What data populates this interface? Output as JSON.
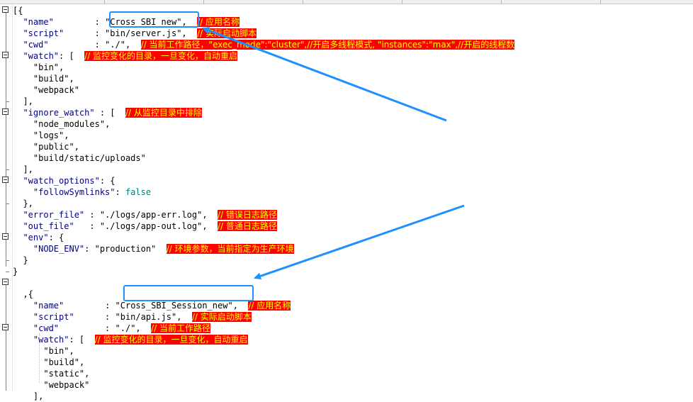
{
  "editor": {
    "lines": [
      [
        {
          "t": "punc",
          "v": "[{"
        }
      ],
      [
        {
          "t": "sp",
          "v": "  "
        },
        {
          "t": "key",
          "v": "\"name\""
        },
        {
          "t": "sp",
          "v": "        : "
        },
        {
          "t": "str",
          "v": "\"Cross_SBI_new\""
        },
        {
          "t": "punc",
          "v": ",  "
        },
        {
          "t": "cmt",
          "v": "// 应用名称"
        }
      ],
      [
        {
          "t": "sp",
          "v": "  "
        },
        {
          "t": "key",
          "v": "\"script\""
        },
        {
          "t": "sp",
          "v": "      : "
        },
        {
          "t": "str",
          "v": "\"bin/server.js\""
        },
        {
          "t": "punc",
          "v": ",  "
        },
        {
          "t": "cmt",
          "v": "// 实际启动脚本"
        }
      ],
      [
        {
          "t": "sp",
          "v": "  "
        },
        {
          "t": "key",
          "v": "\"cwd\""
        },
        {
          "t": "sp",
          "v": "         : "
        },
        {
          "t": "str",
          "v": "\"./\""
        },
        {
          "t": "punc",
          "v": ",  "
        },
        {
          "t": "cmt",
          "v": "// 当前工作路径，\"exec_mode\":\"cluster\",//开启多线程模式, \"instances\":\"max\",//开启的线程数"
        }
      ],
      [
        {
          "t": "sp",
          "v": "  "
        },
        {
          "t": "key",
          "v": "\"watch\""
        },
        {
          "t": "punc",
          "v": ": [  "
        },
        {
          "t": "cmt",
          "v": "// 监控变化的目录，一旦变化，自动重启"
        }
      ],
      [
        {
          "t": "sp",
          "v": "    "
        },
        {
          "t": "str",
          "v": "\"bin\""
        },
        {
          "t": "punc",
          "v": ","
        }
      ],
      [
        {
          "t": "sp",
          "v": "    "
        },
        {
          "t": "str",
          "v": "\"build\""
        },
        {
          "t": "punc",
          "v": ","
        }
      ],
      [
        {
          "t": "sp",
          "v": "    "
        },
        {
          "t": "str",
          "v": "\"webpack\""
        }
      ],
      [
        {
          "t": "sp",
          "v": "  "
        },
        {
          "t": "punc",
          "v": "],"
        }
      ],
      [
        {
          "t": "sp",
          "v": "  "
        },
        {
          "t": "key",
          "v": "\"ignore_watch\""
        },
        {
          "t": "punc",
          "v": " : [  "
        },
        {
          "t": "cmt",
          "v": "// 从监控目录中排除"
        }
      ],
      [
        {
          "t": "sp",
          "v": "    "
        },
        {
          "t": "str",
          "v": "\"node_modules\""
        },
        {
          "t": "punc",
          "v": ","
        }
      ],
      [
        {
          "t": "sp",
          "v": "    "
        },
        {
          "t": "str",
          "v": "\"logs\""
        },
        {
          "t": "punc",
          "v": ","
        }
      ],
      [
        {
          "t": "sp",
          "v": "    "
        },
        {
          "t": "str",
          "v": "\"public\""
        },
        {
          "t": "punc",
          "v": ","
        }
      ],
      [
        {
          "t": "sp",
          "v": "    "
        },
        {
          "t": "str",
          "v": "\"build/static/uploads\""
        }
      ],
      [
        {
          "t": "sp",
          "v": "  "
        },
        {
          "t": "punc",
          "v": "],"
        }
      ],
      [
        {
          "t": "sp",
          "v": "  "
        },
        {
          "t": "key",
          "v": "\"watch_options\""
        },
        {
          "t": "punc",
          "v": ": {"
        }
      ],
      [
        {
          "t": "sp",
          "v": "    "
        },
        {
          "t": "key",
          "v": "\"followSymlinks\""
        },
        {
          "t": "punc",
          "v": ": "
        },
        {
          "t": "bool",
          "v": "false"
        }
      ],
      [
        {
          "t": "sp",
          "v": "  "
        },
        {
          "t": "punc",
          "v": "},"
        }
      ],
      [
        {
          "t": "sp",
          "v": "  "
        },
        {
          "t": "key",
          "v": "\"error_file\""
        },
        {
          "t": "sp",
          "v": " : "
        },
        {
          "t": "str",
          "v": "\"./logs/app-err.log\""
        },
        {
          "t": "punc",
          "v": ",  "
        },
        {
          "t": "cmt",
          "v": "// 错误日志路径"
        }
      ],
      [
        {
          "t": "sp",
          "v": "  "
        },
        {
          "t": "key",
          "v": "\"out_file\""
        },
        {
          "t": "sp",
          "v": "   : "
        },
        {
          "t": "str",
          "v": "\"./logs/app-out.log\""
        },
        {
          "t": "punc",
          "v": ",  "
        },
        {
          "t": "cmt",
          "v": "// 普通日志路径"
        }
      ],
      [
        {
          "t": "sp",
          "v": "  "
        },
        {
          "t": "key",
          "v": "\"env\""
        },
        {
          "t": "punc",
          "v": ": {"
        }
      ],
      [
        {
          "t": "sp",
          "v": "    "
        },
        {
          "t": "key",
          "v": "\"NODE_ENV\""
        },
        {
          "t": "punc",
          "v": ": "
        },
        {
          "t": "str",
          "v": "\"production\""
        },
        {
          "t": "sp",
          "v": "  "
        },
        {
          "t": "cmt",
          "v": "// 环境参数，当前指定为生产环境"
        }
      ],
      [
        {
          "t": "sp",
          "v": "  "
        },
        {
          "t": "punc",
          "v": "}"
        }
      ],
      [
        {
          "t": "punc",
          "v": "}"
        }
      ],
      [],
      [
        {
          "t": "sp",
          "v": "  "
        },
        {
          "t": "punc",
          "v": ",{"
        }
      ],
      [
        {
          "t": "sp",
          "v": "    "
        },
        {
          "t": "key",
          "v": "\"name\""
        },
        {
          "t": "sp",
          "v": "        : "
        },
        {
          "t": "str",
          "v": "\"Cross_SBI_Session_new\""
        },
        {
          "t": "punc",
          "v": ",  "
        },
        {
          "t": "cmt",
          "v": "// 应用名称"
        }
      ],
      [
        {
          "t": "sp",
          "v": "    "
        },
        {
          "t": "key",
          "v": "\"script\""
        },
        {
          "t": "sp",
          "v": "      : "
        },
        {
          "t": "str",
          "v": "\"bin/api.js\""
        },
        {
          "t": "punc",
          "v": ",  "
        },
        {
          "t": "cmt",
          "v": "// 实际启动脚本"
        }
      ],
      [
        {
          "t": "sp",
          "v": "    "
        },
        {
          "t": "key",
          "v": "\"cwd\""
        },
        {
          "t": "sp",
          "v": "         : "
        },
        {
          "t": "str",
          "v": "\"./\""
        },
        {
          "t": "punc",
          "v": ",  "
        },
        {
          "t": "cmt",
          "v": "// 当前工作路径"
        }
      ],
      [
        {
          "t": "sp",
          "v": "    "
        },
        {
          "t": "key",
          "v": "\"watch\""
        },
        {
          "t": "punc",
          "v": ": [  "
        },
        {
          "t": "cmt",
          "v": "// 监控变化的目录，一旦变化，自动重启"
        }
      ],
      [
        {
          "t": "sp",
          "v": "      "
        },
        {
          "t": "str",
          "v": "\"bin\""
        },
        {
          "t": "punc",
          "v": ","
        }
      ],
      [
        {
          "t": "sp",
          "v": "      "
        },
        {
          "t": "str",
          "v": "\"build\""
        },
        {
          "t": "punc",
          "v": ","
        }
      ],
      [
        {
          "t": "sp",
          "v": "      "
        },
        {
          "t": "str",
          "v": "\"static\""
        },
        {
          "t": "punc",
          "v": ","
        }
      ],
      [
        {
          "t": "sp",
          "v": "      "
        },
        {
          "t": "str",
          "v": "\"webpack\""
        }
      ],
      [
        {
          "t": "sp",
          "v": "    "
        },
        {
          "t": "punc",
          "v": "],"
        }
      ]
    ]
  },
  "annotations": {
    "highlight_color": "#1e90ff",
    "comment_bg": "#ff0000",
    "comment_fg": "#ffff00"
  },
  "icons": {
    "fold": "fold-minus-icon",
    "arrow": "annotation-arrow-icon"
  }
}
